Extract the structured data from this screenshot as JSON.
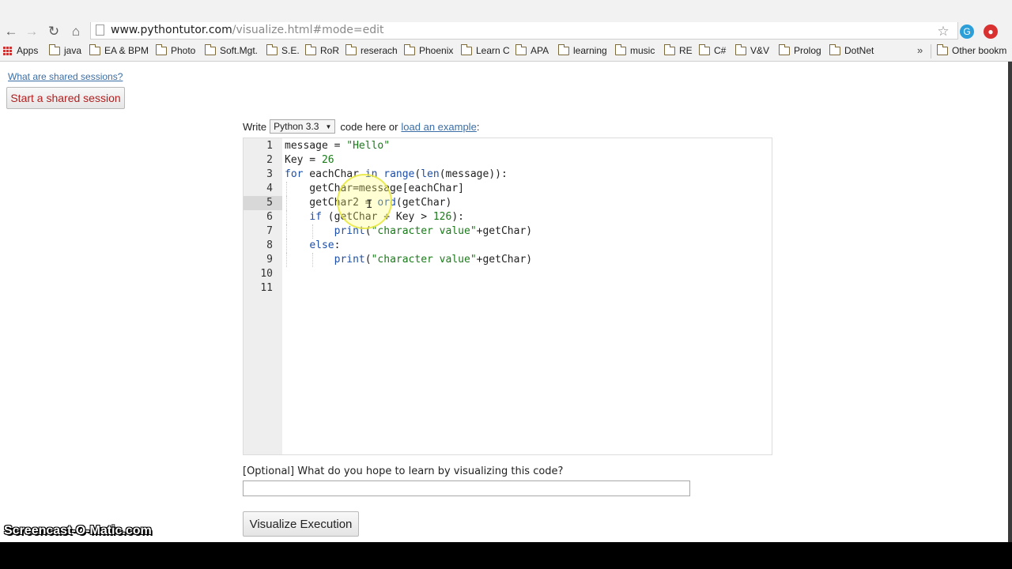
{
  "browser": {
    "url_host": "www.pythontutor.com",
    "url_path": "/visualize.html#mode=edit",
    "bookmarks": [
      "Apps",
      "java",
      "EA & BPM",
      "Photo",
      "Soft.Mgt.",
      "S.E.",
      "RoR",
      "reserach",
      "Phoenix",
      "Learn C",
      "APA",
      "learning",
      "music",
      "RE",
      "C#",
      "V&V",
      "Prolog",
      "DotNet"
    ],
    "bookmarks_more": "»",
    "other_bookmarks": "Other bookm"
  },
  "page": {
    "shared_link": "What are shared sessions?",
    "shared_button": "Start a shared session",
    "write_prefix": "Write",
    "language": "Python 3.3",
    "write_middle": "code here or",
    "load_example": "load an example",
    "write_suffix": ":",
    "optional_label": "[Optional] What do you hope to learn by visualizing this code?",
    "optional_value": "",
    "visualize_button": "Visualize Execution",
    "active_line": 5
  },
  "code": {
    "line_numbers": [
      "1",
      "2",
      "3",
      "4",
      "5",
      "6",
      "7",
      "8",
      "9",
      "10",
      "11"
    ],
    "lines": [
      "message = \"Hello\"",
      "Key = 26",
      "for eachChar in range(len(message)):",
      "    getChar=message[eachChar]",
      "    getChar2 = ord(getChar)",
      "    if (getChar + Key > 126):",
      "        print(\"character value\"+getChar)",
      "    else:",
      "        print(\"character value\"+getChar)",
      "",
      ""
    ]
  },
  "watermark": "Screencast-O-Matic.com",
  "colors": {
    "link": "#3a6ea5",
    "shared_button_text": "#b02020",
    "keyword": "#1e4fa8",
    "string": "#1a7a1a"
  }
}
